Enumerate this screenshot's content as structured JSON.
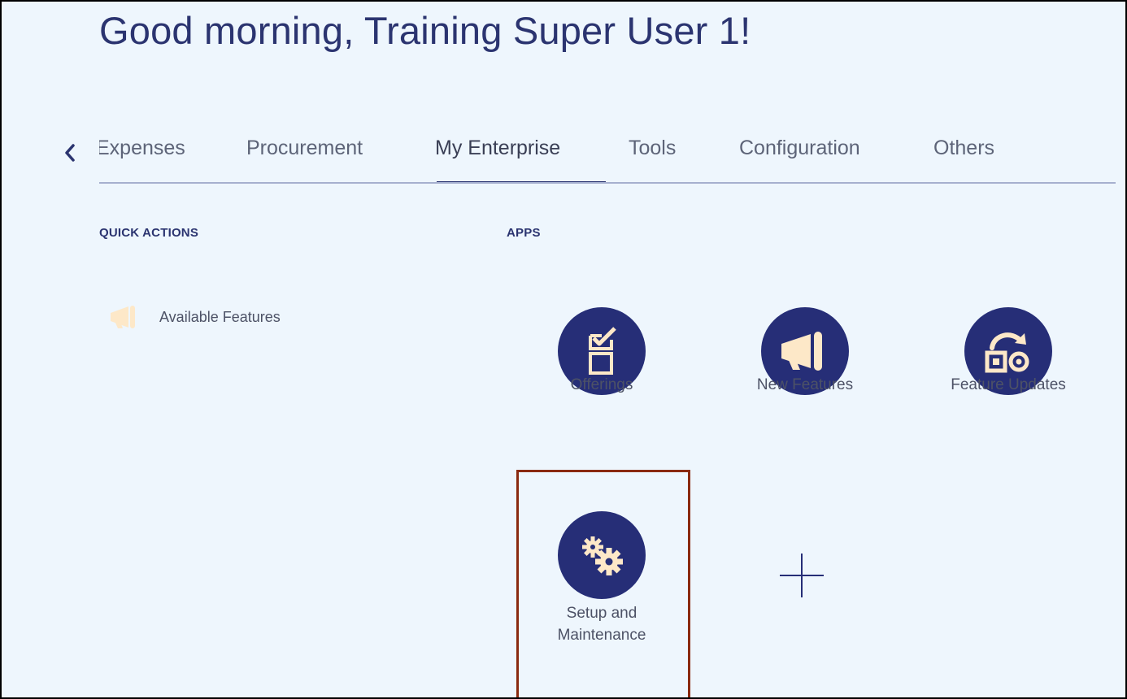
{
  "header": {
    "greeting": "Good morning, Training Super User 1!"
  },
  "tabs": {
    "scroll_left_icon": "chevron-left-icon",
    "items": [
      {
        "label": "Expenses",
        "active": false
      },
      {
        "label": "Procurement",
        "active": false
      },
      {
        "label": "My Enterprise",
        "active": true
      },
      {
        "label": "Tools",
        "active": false
      },
      {
        "label": "Configuration",
        "active": false
      },
      {
        "label": "Others",
        "active": false
      }
    ]
  },
  "quick_actions": {
    "heading": "QUICK ACTIONS",
    "items": [
      {
        "label": "Available Features",
        "icon": "megaphone-icon"
      }
    ]
  },
  "apps": {
    "heading": "APPS",
    "items": [
      {
        "label": "Offerings",
        "icon": "checklist-icon"
      },
      {
        "label": "New Features",
        "icon": "megaphone-icon"
      },
      {
        "label": "Feature Updates",
        "icon": "feature-update-icon"
      },
      {
        "label": "Setup and Maintenance",
        "icon": "gears-icon"
      }
    ],
    "add_icon": "plus-icon"
  },
  "colors": {
    "background": "#eef6fd",
    "accent": "#262e77",
    "icon_fill": "#fde8c8",
    "highlight": "#8a2a10"
  }
}
